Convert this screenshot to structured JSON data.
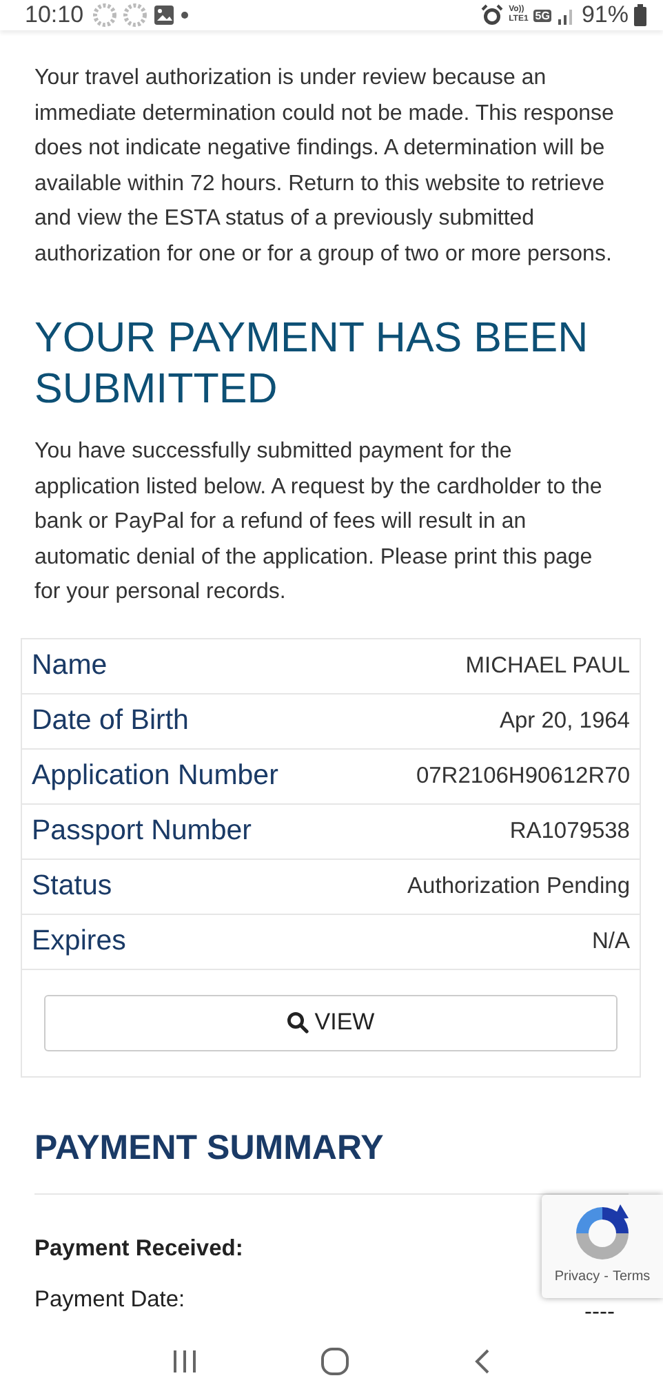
{
  "status_bar": {
    "time": "10:10",
    "volte": "Vo))",
    "lte": "LTE1",
    "network": "5G",
    "battery": "91%"
  },
  "notice": "Your travel authorization is under review because an immediate determination could not be made. This response does not indicate negative findings. A determination will be available within 72 hours. Return to this website to retrieve and view the ESTA status of a previously submitted authorization for one or for a group of two or more persons.",
  "heading": "YOUR PAYMENT HAS BEEN SUBMITTED",
  "message": "You have successfully submitted payment for the application listed below. A request by the cardholder to the bank or PayPal for a refund of fees will result in an automatic denial of the application. Please print this page for your personal records.",
  "details": [
    {
      "label": "Name",
      "value": "MICHAEL PAUL"
    },
    {
      "label": "Date of Birth",
      "value": "Apr 20, 1964"
    },
    {
      "label": "Application Number",
      "value": "07R2106H90612R70"
    },
    {
      "label": "Passport Number",
      "value": "RA1079538"
    },
    {
      "label": "Status",
      "value": "Authorization Pending"
    },
    {
      "label": "Expires",
      "value": "N/A"
    }
  ],
  "view_button": "VIEW",
  "summary": {
    "title": "PAYMENT SUMMARY",
    "received_label": "Payment Received:",
    "date_label": "Payment Date:",
    "date_value": "----"
  },
  "recaptcha": {
    "privacy": "Privacy",
    "separator": "-",
    "terms": "Terms"
  }
}
